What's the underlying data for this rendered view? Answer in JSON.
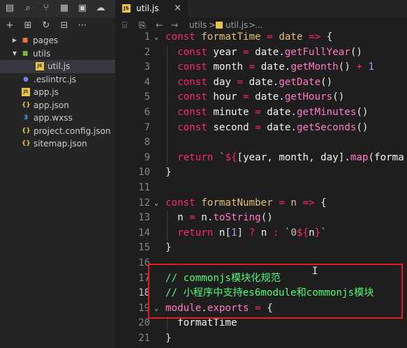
{
  "sidebar": {
    "activity_icons": [
      "files-icon",
      "search-icon",
      "source-control-icon",
      "extensions-icon",
      "debug-icon",
      "cloud-icon"
    ],
    "toolbar_icons": [
      "new-file-icon",
      "new-folder-icon",
      "refresh-icon",
      "collapse-icon",
      "more-icon"
    ],
    "tree": [
      {
        "label": "pages",
        "type": "folder",
        "expanded": false,
        "color": "#e8744a"
      },
      {
        "label": "utils",
        "type": "folder",
        "expanded": true,
        "color": "#7cb342"
      },
      {
        "label": "util.js",
        "type": "js",
        "selected": true,
        "color": "#e8c547"
      },
      {
        "label": ".eslintrc.js",
        "type": "eslint",
        "color": "#7b83eb"
      },
      {
        "label": "app.js",
        "type": "js",
        "color": "#e8c547"
      },
      {
        "label": "app.json",
        "type": "json",
        "color": "#e8c547"
      },
      {
        "label": "app.wxss",
        "type": "css",
        "color": "#42a5f5"
      },
      {
        "label": "project.config.json",
        "type": "json",
        "color": "#e8c547"
      },
      {
        "label": "sitemap.json",
        "type": "json",
        "color": "#e8c547"
      }
    ]
  },
  "editor": {
    "tab": {
      "label": "util.js",
      "icon_text": "JS",
      "close": "×"
    },
    "breadcrumb": {
      "back": "←",
      "forward": "→",
      "folder": "utils",
      "sep": ">",
      "file": "util.js",
      "sep2": ">",
      "more": "..."
    },
    "lines": [
      {
        "n": "1",
        "html": "<span class=\"kw\">const</span> <span class=\"fn\">formatTime</span> <span class=\"op\">=</span> <span class=\"fn\">date</span> <span class=\"op\">=&gt;</span> <span class=\"plain\">{</span>",
        "fold": true
      },
      {
        "n": "2",
        "html": "  <span class=\"kw\">const</span> <span class=\"name\">year</span> <span class=\"op\">=</span> <span class=\"name\">date</span><span class=\"plain\">.</span><span class=\"mth\">getFullYear</span><span class=\"plain\">()</span>"
      },
      {
        "n": "3",
        "html": "  <span class=\"kw\">const</span> <span class=\"name\">month</span> <span class=\"op\">=</span> <span class=\"name\">date</span><span class=\"plain\">.</span><span class=\"mth\">getMonth</span><span class=\"plain\">()</span> <span class=\"op\">+</span> <span class=\"num\">1</span>"
      },
      {
        "n": "4",
        "html": "  <span class=\"kw\">const</span> <span class=\"name\">day</span> <span class=\"op\">=</span> <span class=\"name\">date</span><span class=\"plain\">.</span><span class=\"mth\">getDate</span><span class=\"plain\">()</span>"
      },
      {
        "n": "5",
        "html": "  <span class=\"kw\">const</span> <span class=\"name\">hour</span> <span class=\"op\">=</span> <span class=\"name\">date</span><span class=\"plain\">.</span><span class=\"mth\">getHours</span><span class=\"plain\">()</span>"
      },
      {
        "n": "6",
        "html": "  <span class=\"kw\">const</span> <span class=\"name\">minute</span> <span class=\"op\">=</span> <span class=\"name\">date</span><span class=\"plain\">.</span><span class=\"mth\">getMinutes</span><span class=\"plain\">()</span>"
      },
      {
        "n": "7",
        "html": "  <span class=\"kw\">const</span> <span class=\"name\">second</span> <span class=\"op\">=</span> <span class=\"name\">date</span><span class=\"plain\">.</span><span class=\"mth\">getSeconds</span><span class=\"plain\">()</span>"
      },
      {
        "n": "8",
        "html": ""
      },
      {
        "n": "9",
        "html": "  <span class=\"kw\">return</span> <span class=\"str\">`</span><span class=\"op\">${</span><span class=\"plain\">[</span><span class=\"name\">year</span><span class=\"plain\">,</span> <span class=\"name\">month</span><span class=\"plain\">,</span> <span class=\"name\">day</span><span class=\"plain\">].</span><span class=\"mth\">map</span><span class=\"plain\">(</span><span class=\"name\">forma</span>"
      },
      {
        "n": "10",
        "html": "<span class=\"plain\">}</span>"
      },
      {
        "n": "11",
        "html": ""
      },
      {
        "n": "12",
        "html": "<span class=\"kw\">const</span> <span class=\"fn\">formatNumber</span> <span class=\"op\">=</span> <span class=\"fn\">n</span> <span class=\"op\">=&gt;</span> <span class=\"plain\">{</span>",
        "fold": true
      },
      {
        "n": "13",
        "html": "  <span class=\"name\">n</span> <span class=\"op\">=</span> <span class=\"name\">n</span><span class=\"plain\">.</span><span class=\"mth\">toString</span><span class=\"plain\">()</span>"
      },
      {
        "n": "14",
        "html": "  <span class=\"kw\">return</span> <span class=\"name\">n</span><span class=\"plain\">[</span><span class=\"num\">1</span><span class=\"plain\">]</span> <span class=\"op\">?</span> <span class=\"name\">n</span> <span class=\"op\">:</span> <span class=\"str\">`0</span><span class=\"op\">${</span><span class=\"name\">n</span><span class=\"op\">}</span><span class=\"str\">`</span>"
      },
      {
        "n": "15",
        "html": "<span class=\"plain\">}</span>"
      },
      {
        "n": "16",
        "html": ""
      },
      {
        "n": "17",
        "html": "<span class=\"com\">// commonjs模块化规范</span>"
      },
      {
        "n": "18",
        "html": "<span class=\"com\">// 小程序中支持es6module和commonjs模块</span>",
        "active": true
      },
      {
        "n": "19",
        "html": "<span class=\"mth\">module</span><span class=\"plain\">.</span><span class=\"mth\">exports</span> <span class=\"op\">=</span> <span class=\"plain\">{</span>",
        "fold": true
      },
      {
        "n": "20",
        "html": "  <span class=\"name\">formatTime</span>"
      },
      {
        "n": "21",
        "html": "<span class=\"plain\">}</span>"
      }
    ]
  },
  "colors": {
    "highlight_box": "#e51c23"
  }
}
